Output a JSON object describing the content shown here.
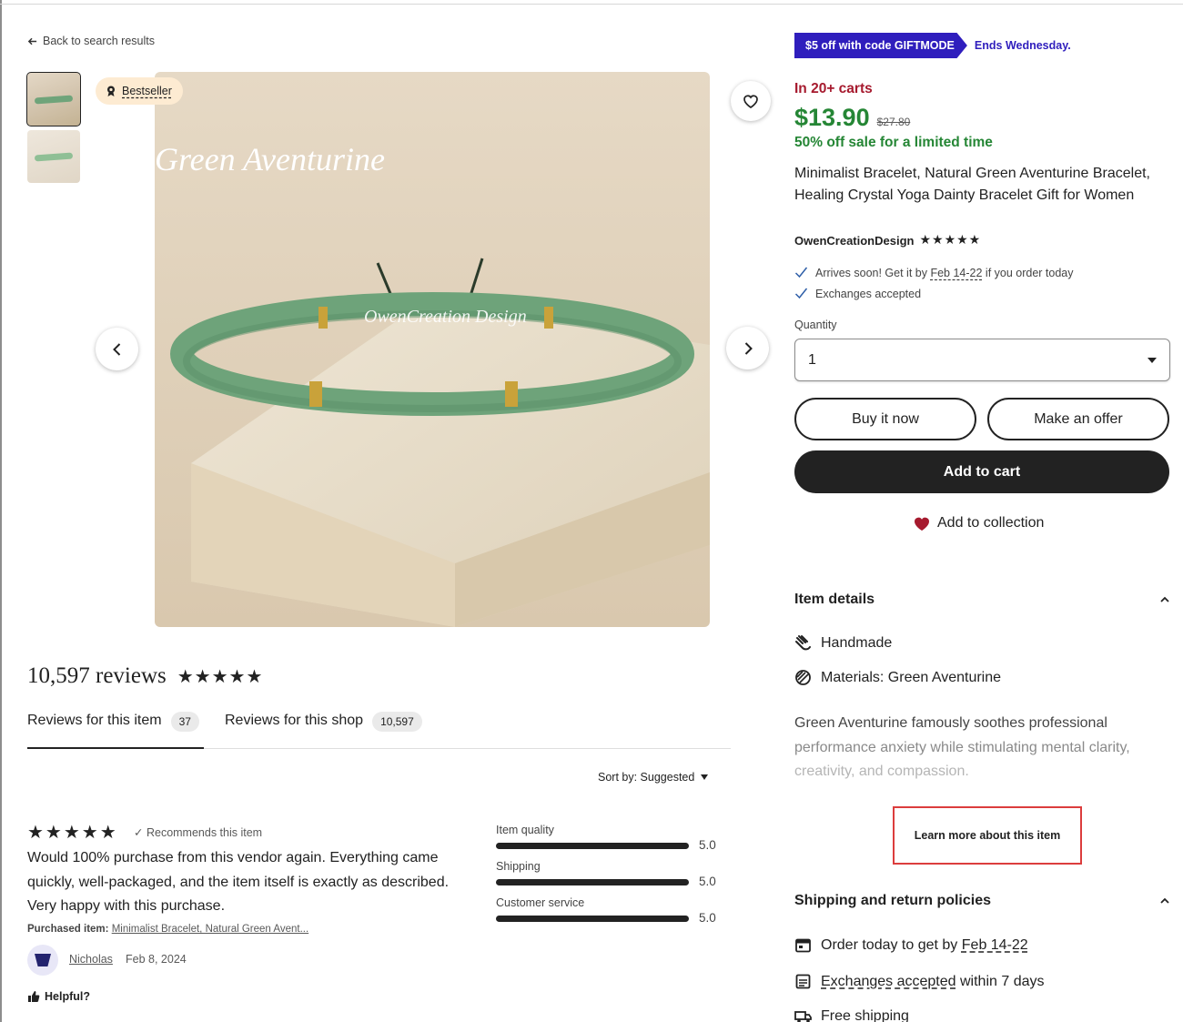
{
  "nav": {
    "back_label": "Back to search results"
  },
  "gallery": {
    "badge": "Bestseller",
    "overlay_title": "Green  Aventurine",
    "overlay_watermark": "OwenCreation Design"
  },
  "reviews": {
    "count_label": "10,597 reviews",
    "stars": "★★★★★",
    "tabs": [
      {
        "label": "Reviews for this item",
        "count": "37"
      },
      {
        "label": "Reviews for this shop",
        "count": "10,597"
      }
    ],
    "sort_label": "Sort by: Suggested",
    "review": {
      "stars": "★★★★★",
      "recommends": "Recommends this item",
      "text": "Would 100% purchase from this vendor again. Everything came quickly, well-packaged, and the item itself is exactly as described. Very happy with this purchase.",
      "purchased_label": "Purchased item:",
      "purchased_item": "Minimalist Bracelet, Natural Green Avent...",
      "reviewer": "Nicholas",
      "date": "Feb 8, 2024",
      "helpful": "Helpful?"
    },
    "ratings": [
      {
        "label": "Item quality",
        "value": "5.0"
      },
      {
        "label": "Shipping",
        "value": "5.0"
      },
      {
        "label": "Customer service",
        "value": "5.0"
      }
    ]
  },
  "listing": {
    "promo_tag": "$5 off with code GIFTMODE",
    "promo_ends": "Ends Wednesday.",
    "carts": "In 20+ carts",
    "price": "$13.90",
    "original_price": "$27.80",
    "sale_text": "50% off sale for a limited time",
    "title": "Minimalist Bracelet, Natural Green Aventurine Bracelet, Healing Crystal Yoga Dainty Bracelet Gift for Women",
    "shop_name": "OwenCreationDesign",
    "shop_stars": "★★★★★",
    "arrives_prefix": "Arrives soon! Get it by",
    "arrives_date": "Feb 14-22",
    "arrives_suffix": "if you order today",
    "exchanges": "Exchanges accepted",
    "quantity_label": "Quantity",
    "quantity_value": "1",
    "buy_now": "Buy it now",
    "make_offer": "Make an offer",
    "add_to_cart": "Add to cart",
    "add_to_collection": "Add to collection"
  },
  "item_details": {
    "heading": "Item details",
    "handmade": "Handmade",
    "materials": "Materials: Green Aventurine",
    "desc_line1": "Green Aventurine famously soothes professional",
    "desc_line2": "performance anxiety while stimulating mental clarity,",
    "desc_line3": "creativity, and compassion.",
    "learn_more": "Learn more about this item"
  },
  "shipping": {
    "heading": "Shipping and return policies",
    "order_prefix": "Order today to get by",
    "order_date": "Feb 14-22",
    "exchanges_link": "Exchanges accepted",
    "exchanges_suffix": "within 7 days",
    "free_shipping": "Free shipping"
  },
  "colors": {
    "promo": "#2f1ebd",
    "price_green": "#258635",
    "carts_red": "#a61a2e",
    "heart": "#a61a2e",
    "highlight_box": "#dc3d3d"
  }
}
